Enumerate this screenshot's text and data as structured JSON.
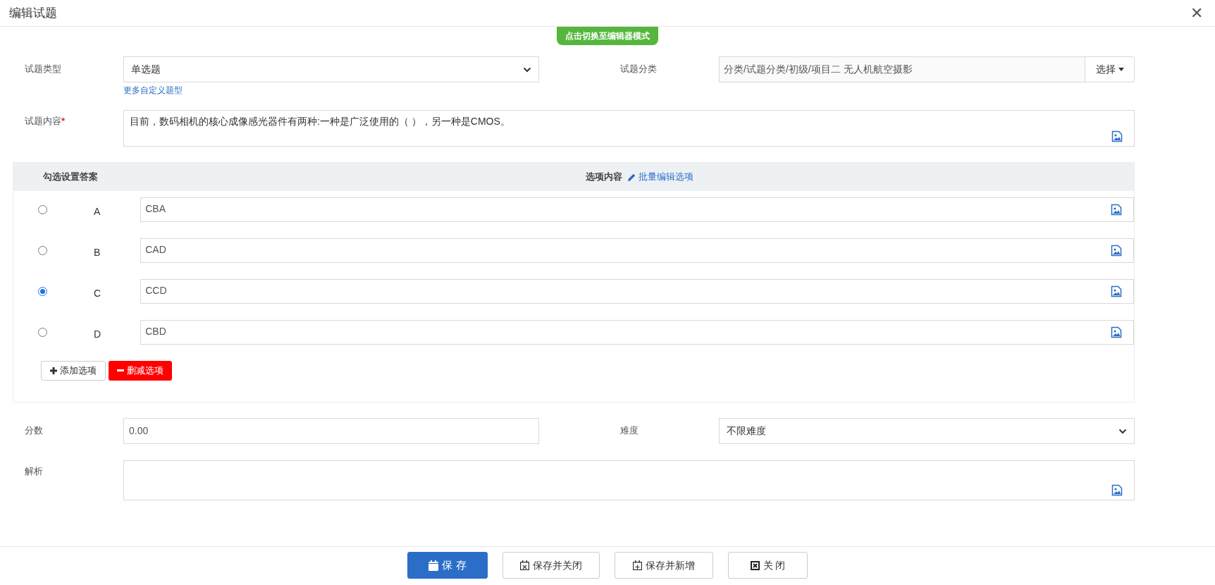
{
  "dialog": {
    "title": "编辑试题",
    "close": "✕"
  },
  "mode_switch": "点击切换至编辑器模式",
  "question_type": {
    "label": "试题类型",
    "value": "单选题",
    "link": "更多自定义题型"
  },
  "category": {
    "label": "试题分类",
    "value": "分类/试题分类/初级/项目二 无人机航空摄影",
    "button": "选择"
  },
  "content": {
    "label": "试题内容",
    "required_mark": "*",
    "value": "目前，数码相机的核心成像感光器件有两种:一种是广泛使用的（   ），另一种是CMOS。"
  },
  "options_table": {
    "answer_header": "勾选设置答案",
    "content_header": "选项内容",
    "batch_edit": "批量编辑选项",
    "options": [
      {
        "letter": "A",
        "value": "CBA",
        "selected": false
      },
      {
        "letter": "B",
        "value": "CAD",
        "selected": false
      },
      {
        "letter": "C",
        "value": "CCD",
        "selected": true
      },
      {
        "letter": "D",
        "value": "CBD",
        "selected": false
      }
    ],
    "add_button": "添加选项",
    "remove_button": "删减选项"
  },
  "score": {
    "label": "分数",
    "value": "0.00"
  },
  "difficulty": {
    "label": "难度",
    "value": "不限难度"
  },
  "analysis": {
    "label": "解析"
  },
  "footer_buttons": [
    {
      "label": "保 存",
      "kind": "primary"
    },
    {
      "label": "保存并关闭",
      "kind": "save_close"
    },
    {
      "label": "保存并新增",
      "kind": "save_new"
    },
    {
      "label": "关 闭",
      "kind": "close"
    }
  ]
}
